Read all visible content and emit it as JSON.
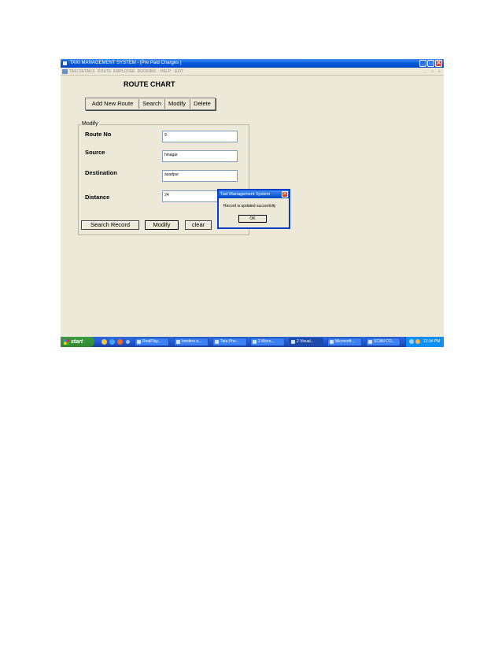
{
  "window": {
    "title": "TAXI MANAGEMENT SYSTEM - [Pre Paid Charges ]",
    "controls": {
      "minimize": "_",
      "maximize": "□",
      "close": "✕"
    },
    "menu": [
      "TAXI DETAILS",
      "ROUTE",
      "EMPLOYEE",
      "BOOKING",
      "HELP",
      "EXIT"
    ],
    "mdi_controls": [
      "_",
      "□",
      "x"
    ]
  },
  "form": {
    "heading": "ROUTE CHART",
    "tabs": [
      "Add New Route",
      "Search",
      "Modify",
      "Delete"
    ],
    "frame_label": "Modify",
    "fields": [
      {
        "label": "Route No",
        "value": "9"
      },
      {
        "label": "Source",
        "value": "hinagar"
      },
      {
        "label": "Destination",
        "value": "azadpur"
      },
      {
        "label": "Distance",
        "value": "24"
      }
    ],
    "buttons": {
      "search": "Search Record",
      "modify": "Modify",
      "clear": "clear"
    }
  },
  "dialog": {
    "title": "Taxi Management System",
    "message": "Record is updated succesfully",
    "ok": "OK",
    "close": "✕"
  },
  "taskbar": {
    "start": "start",
    "tasks": [
      "RealPlay...",
      "borders o...",
      "Tata Pho...",
      "2 Micro...",
      "2 Visual...",
      "Microsoft...",
      "SCAN CO..."
    ],
    "clock": "12:34 PM"
  }
}
